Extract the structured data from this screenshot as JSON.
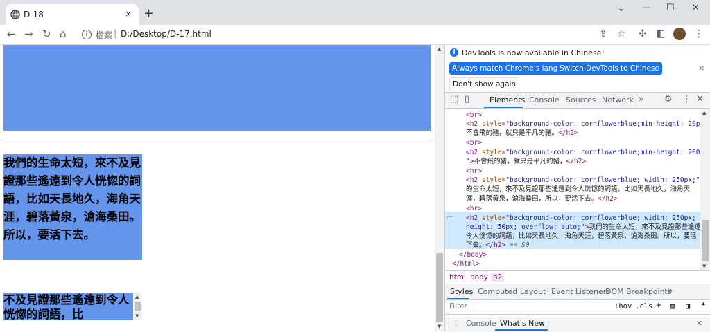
{
  "browser": {
    "tab_title": "D-18",
    "tab_close": "×",
    "new_tab": "+",
    "win_min": "⌄",
    "win_minimize": "—",
    "win_restore": "☐",
    "win_close": "✕",
    "url_scheme": "檔案",
    "url_sep": "|",
    "url": "D:/Desktop/D-17.html"
  },
  "page": {
    "h2_wide_text": "我們的生命太短，來不及見證那些遙遠到令人恍惚的詞語，比如天長地久，海角天涯，碧落黃泉，滄海桑田。所以，要活下去。",
    "h2_scroll_text": "不及見證那些遙遠到令人恍惚的詞語，比"
  },
  "devtools": {
    "notice_text": "DevTools is now available in Chinese!",
    "btn_match": "Always match Chrome's language",
    "btn_switch": "Switch DevTools to Chinese",
    "btn_dont_show": "Don't show again",
    "notice_close": "×",
    "tabs": [
      "Elements",
      "Console",
      "Sources",
      "Network",
      "»"
    ],
    "crumbs": [
      "html",
      "body",
      "h2"
    ],
    "styles_tabs": [
      "Styles",
      "Computed",
      "Layout",
      "Event Listeners",
      "DOM Breakpoints",
      "»"
    ],
    "filter_placeholder": "Filter",
    "filter_hov": ":hov",
    "filter_cls": ".cls",
    "filter_plus": "+",
    "drawer_tabs": [
      "Console",
      "What's New"
    ],
    "drawer_tab_close": "×",
    "drawer_close": "✕",
    "code": {
      "l0": "<br>",
      "l1_tag": "<h2",
      "l1_attr": " style=",
      "l1_val": "\"background-color: cornflowerblue;min-height: 20px;\"",
      "l1_end": ">",
      "l2_text": "不會飛的豬，就只是平凡的豬。",
      "l2_close": "</h2>",
      "l3": "<br>",
      "l4_tag": "<h2",
      "l4_attr": " style=",
      "l4_val": "\"background-color: cornflowerblue;min-height: 200px;",
      "l5_val": "\"",
      "l5_end": ">",
      "l5_text": "不會飛的豬，就只是平凡的豬，",
      "l5_close": "</h2>",
      "l6": "<hr>",
      "l7_tag": "<h2",
      "l7_attr": " style=",
      "l7_val": "\"background-color: cornflowerblue; width: 250px;\"",
      "l7_end": ">",
      "l7_text": "我們",
      "l8_text": "的生命太短，來不及見證那些遙遠到令人恍惚的詞語，比如天長地久，海角天",
      "l9_text": "涯，碧落黃泉，滄海桑田，所以，要活下去。",
      "l9_close": "</h2>",
      "l10": "<br>",
      "l11_tag": "<h2",
      "l11_attr": " style=",
      "l11_val": "\"background-color: cornflowerblue; width: 250px; max-",
      "l12_val": "height: 50px; overflow: auto;\"",
      "l12_end": ">",
      "l12_text": "我們的生命太短，來不及見證那些遙遠到",
      "l13_text": "令人恍惚的詞語，比如天長地久，海角天涯，碧落黃泉，滄海桑田。所以，要活",
      "l14_text": "下去。",
      "l14_close": "</h2>",
      "l14_eq": " == $0",
      "l15": "</body>",
      "l16": "</html>",
      "dots": "···"
    }
  }
}
